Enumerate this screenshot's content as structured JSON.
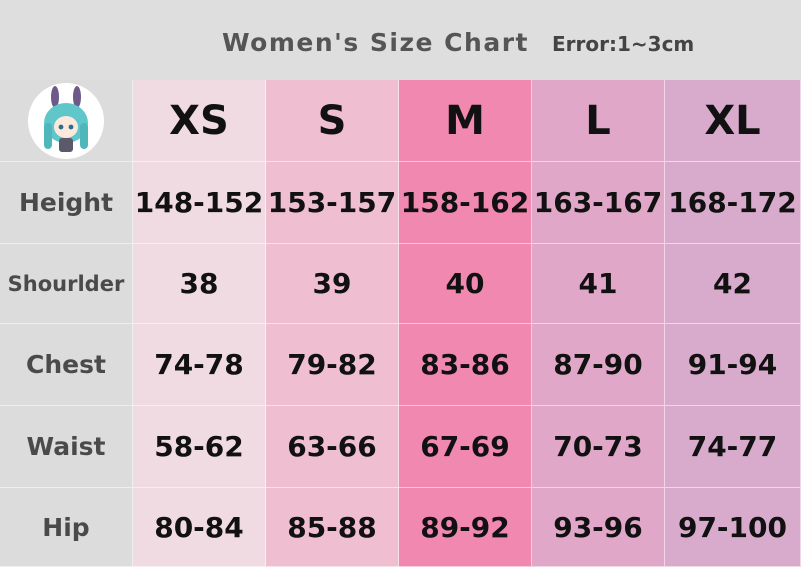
{
  "header": {
    "title": "Women's Size Chart",
    "error_note": "Error:1~3cm"
  },
  "table": {
    "sizes": [
      "XS",
      "S",
      "M",
      "L",
      "XL"
    ],
    "rows": [
      {
        "label": "Height",
        "values": [
          "148-152",
          "153-157",
          "158-162",
          "163-167",
          "168-172"
        ]
      },
      {
        "label": "Shourlder",
        "values": [
          "38",
          "39",
          "40",
          "41",
          "42"
        ]
      },
      {
        "label": "Chest",
        "values": [
          "74-78",
          "79-82",
          "83-86",
          "87-90",
          "91-94"
        ]
      },
      {
        "label": "Waist",
        "values": [
          "58-62",
          "63-66",
          "67-69",
          "70-73",
          "74-77"
        ]
      },
      {
        "label": "Hip",
        "values": [
          "80-84",
          "85-88",
          "89-92",
          "93-96",
          "97-100"
        ]
      }
    ]
  },
  "colors": {
    "xs": "#f1dbe2",
    "s": "#efbfd1",
    "m": "#f088b0",
    "l": "#e0a7c8",
    "xl": "#d8aacb",
    "label_bg": "#dcdcdc"
  },
  "icons": {
    "logo": "chibi-character-avatar-icon"
  }
}
